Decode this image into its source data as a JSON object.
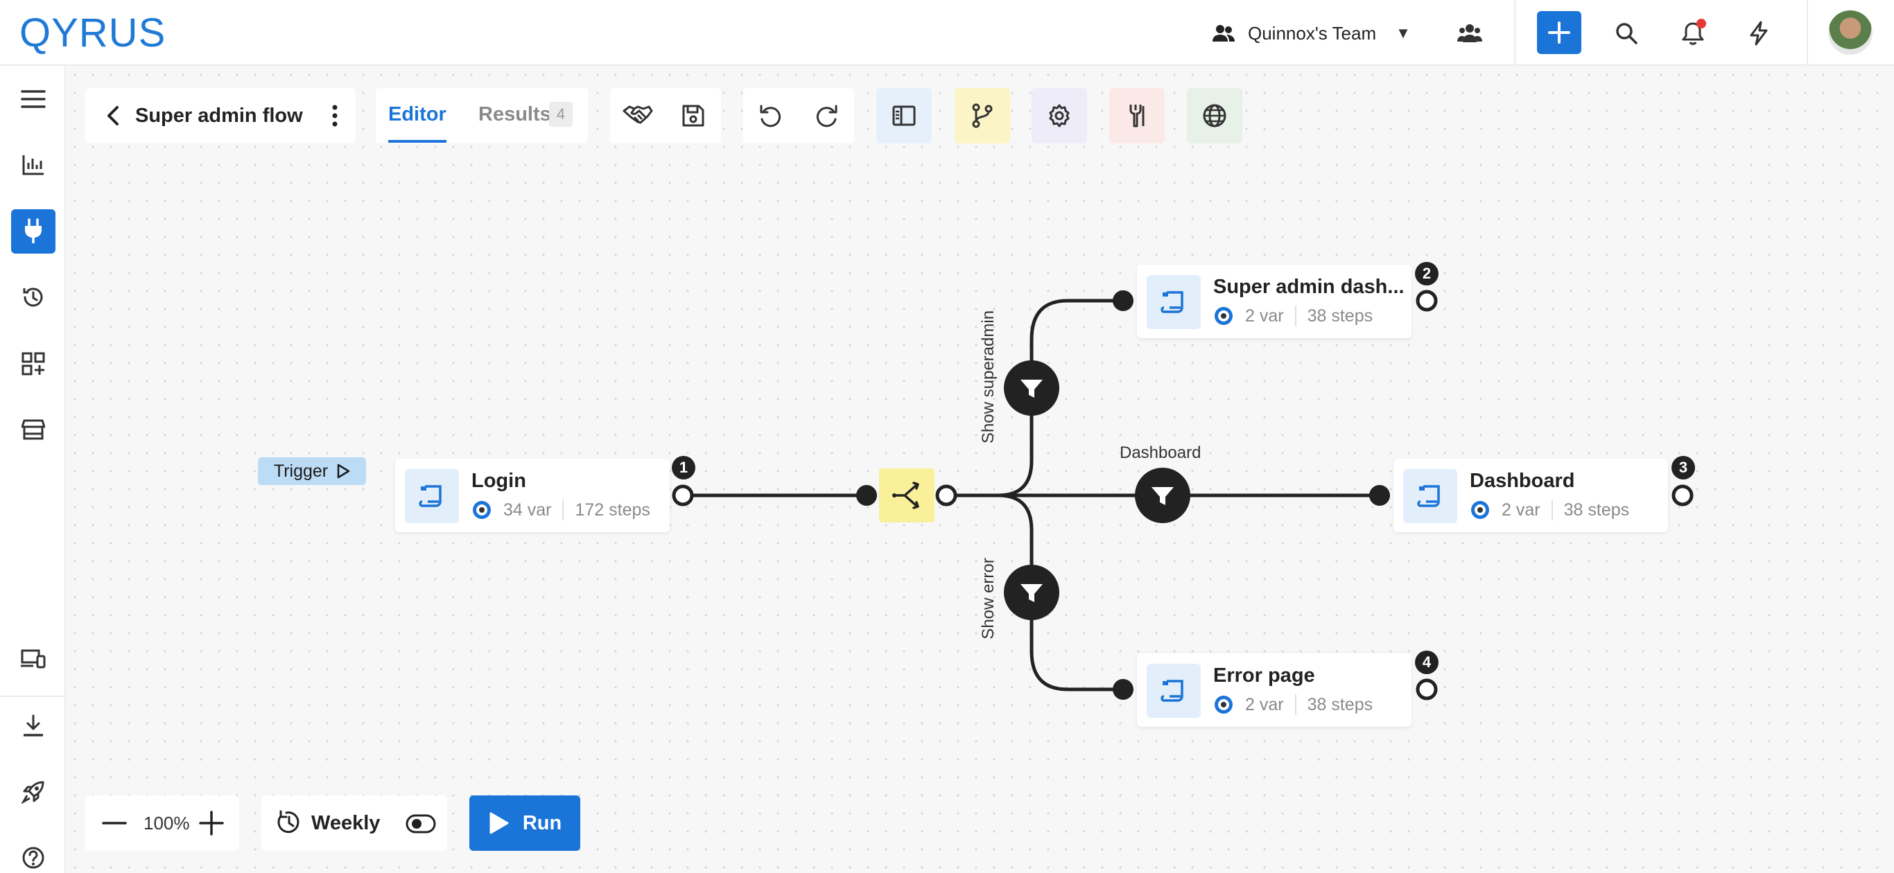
{
  "app": {
    "logo_text": "QYRUS"
  },
  "header": {
    "team_name": "Quinnox's Team",
    "icons": [
      "team-icon",
      "caret-down-icon",
      "users-icon",
      "plus-icon",
      "search-icon",
      "bell-icon",
      "lightning-icon",
      "avatar"
    ]
  },
  "sidebar": {
    "items": [
      "menu-icon",
      "bar-chart-icon",
      "plug-icon",
      "history-icon",
      "add-widget-icon",
      "store-icon",
      "devices-icon",
      "download-icon",
      "rocket-icon",
      "help-icon"
    ],
    "active": "plug-icon"
  },
  "toolbar": {
    "flow_name": "Super admin flow",
    "tabs": [
      {
        "label": "Editor",
        "active": true
      },
      {
        "label": "Results",
        "count": "4",
        "active": false
      }
    ],
    "colors": {
      "panel_blue": "#e6f0fb",
      "panel_yellow": "#fbf4c6",
      "panel_purple": "#eeecf8",
      "panel_red": "#fbe9e7",
      "panel_green": "#e7f1e8"
    }
  },
  "flow": {
    "trigger_label": "Trigger",
    "nodes": [
      {
        "title": "Login",
        "vars": "34 var",
        "steps": "172 steps",
        "badge": "1"
      },
      {
        "title": "Super admin dash...",
        "vars": "2 var",
        "steps": "38 steps",
        "badge": "2"
      },
      {
        "title": "Dashboard",
        "vars": "2 var",
        "steps": "38 steps",
        "badge": "3"
      },
      {
        "title": "Error page",
        "vars": "2 var",
        "steps": "38 steps",
        "badge": "4"
      }
    ],
    "edges": {
      "top": "Show superadmin",
      "middle": "Dashboard",
      "bottom": "Show error"
    }
  },
  "bottom": {
    "zoom": "100%",
    "schedule": "Weekly",
    "run_label": "Run"
  },
  "colors": {
    "accent": "#1b74d8",
    "dark": "#222222",
    "split": "#fbf09a"
  }
}
